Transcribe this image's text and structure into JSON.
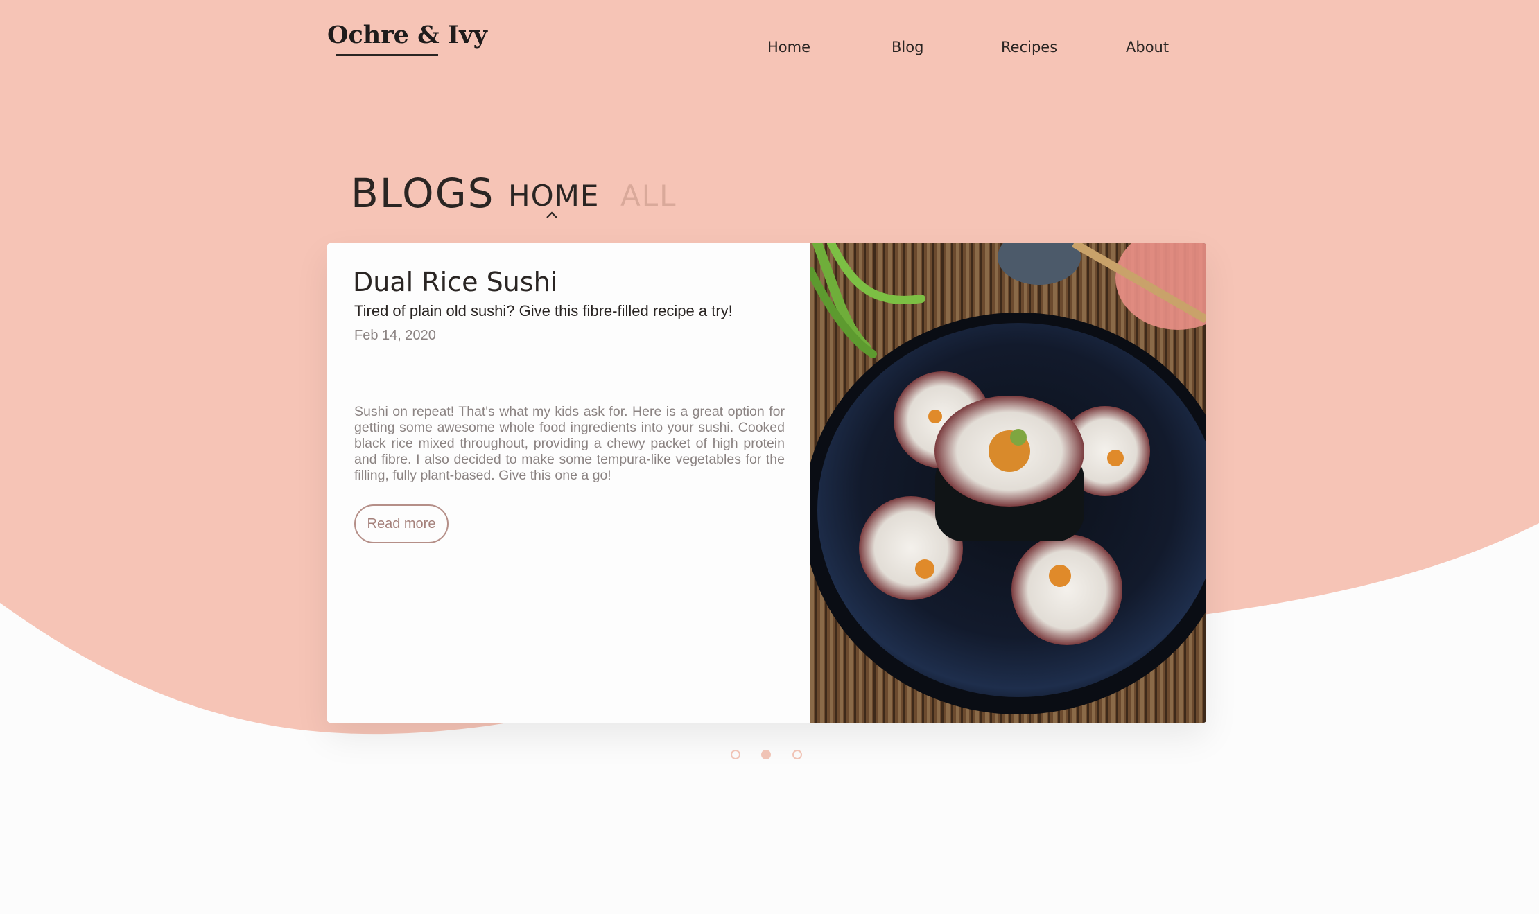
{
  "colors": {
    "hero_bg": "#f6c4b6",
    "page_bg": "#fcfcfc",
    "text_dark": "#2a2523",
    "text_muted": "#8b8382",
    "tab_inactive": "#d9a99a",
    "accent_outline": "#b58f88",
    "dot": "#f0c3b5"
  },
  "header": {
    "logo": "Ochre & Ivy",
    "nav": [
      {
        "label": "Home"
      },
      {
        "label": "Blog"
      },
      {
        "label": "Recipes"
      },
      {
        "label": "About"
      }
    ]
  },
  "section": {
    "title": "BLOGS",
    "tabs": [
      {
        "label": "HOME",
        "active": true
      },
      {
        "label": "ALL",
        "active": false
      }
    ],
    "active_indicator_icon": "chevron-up-icon"
  },
  "post": {
    "title": "Dual Rice Sushi",
    "subtitle": "Tired of plain old sushi? Give this fibre-filled recipe a try!",
    "date": "Feb 14, 2020",
    "excerpt": "Sushi on repeat! That's what my kids ask for. Here is a great option for getting some awesome whole food ingredients into your sushi. Cooked black rice mixed throughout, providing a chewy packet of high protein and fibre. I also decided to make some tempura-like vegetables for the filling, fully plant-based. Give this one a go!",
    "read_more_label": "Read more",
    "image_subject": "sushi-rolls-photo"
  },
  "carousel": {
    "total_slides": 3,
    "active_slide": 2
  }
}
